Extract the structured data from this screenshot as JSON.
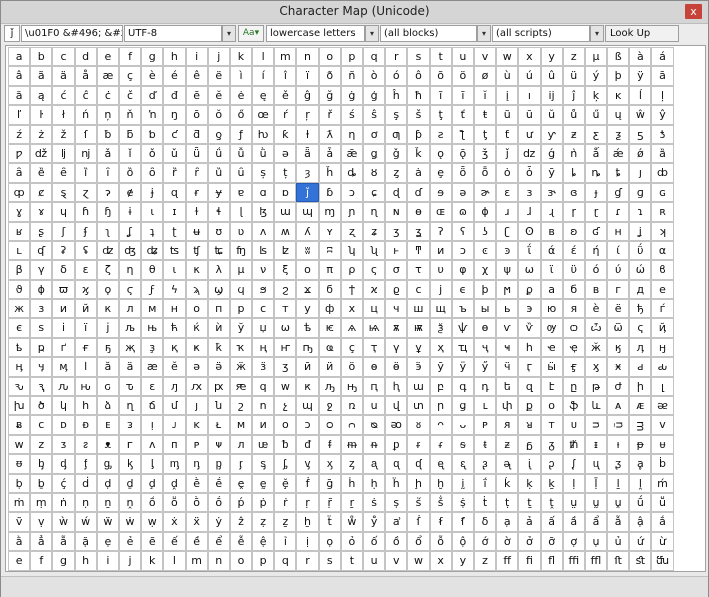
{
  "window": {
    "title": "Character Map (Unicode)",
    "close_glyph": "x"
  },
  "toolbar": {
    "selected_char": "ǰ",
    "code_fields": "\\u01F0  &#496;  &#x1F0;",
    "encoding": "UTF-8",
    "char_picker_icon": "character-picker-icon",
    "filter": "lowercase letters",
    "block": "(all blocks)",
    "script": "(all scripts)",
    "lookup_label": "Look Up",
    "dropdown_arrow": "▾"
  },
  "grid": {
    "selected_row": 7,
    "selected_col": 13,
    "rows": [
      "a b c d e f g h i j k l m n o p q r s t u v w x y z µ ß à á",
      "â ã ä å æ ç è é ê ë ì í î ï ð ñ ò ó ô õ ö ø ù ú û ü ý þ ÿ ā",
      "ă ą ć ĉ ċ č ď đ ē ĕ ė ę ě ĝ ğ ġ ģ ĥ ħ ĩ ī ĭ į ı ĳ ĵ ķ ĸ ĺ ļ",
      "ľ ŀ ł ń ņ ň ŉ ŋ ō ŏ ő œ ŕ ŗ ř ś ŝ ş š ţ ť ŧ ũ ū ŭ ů ű ų ŵ ŷ",
      "ź ż ž ſ ƀ ƃ ƅ ƈ ƌ ƍ ƒ ƕ ƙ ƚ ƛ ƞ ơ ƣ ƥ ƨ ƪ ƫ ƭ ư ƴ ƶ ƹ ƺ ƽ ƾ",
      "ƿ ǆ ǉ ǌ ǎ ǐ ǒ ǔ ǖ ǘ ǚ ǜ ǝ ǟ ǡ ǣ ǥ ǧ ǩ ǫ ǭ ǯ ǰ ǳ ǵ ǹ ǻ ǽ ǿ ȁ",
      "ȃ ȅ ȇ ȉ ȋ ȍ ȏ ȑ ȓ ȕ ȗ ș ț ȝ ȟ ȡ ȣ ȥ ȧ ȩ ȫ ȭ ȯ ȱ ȳ ȴ ȵ ȶ ȷ ȸ",
      "ȹ ȼ ȿ ɀ ɂ ɇ ɉ ɋ ɍ ɏ ɐ ɑ ɒ ǰ ɓ ɔ ɕ ɖ ɗ ɘ ə ɚ ɛ ɜ ɝ ɞ ɟ ɠ ɡ ɢ",
      "ɣ ɤ ɥ ɦ ɧ ɨ ɩ ɪ ɫ ɬ ɭ ɮ ɯ ɰ ɱ ɲ ɳ ɴ ɵ ɶ ɷ ɸ ɹ ɺ ɻ ɼ ɽ ɾ ɿ ʀ",
      "ʁ ʂ ʃ ʄ ʅ ʆ ʇ ʈ ʉ ʊ ʋ ʌ ʍ ʎ ʏ ʐ ʑ ʒ ʓ ʔ ʕ ʖ ʗ ʘ ʙ ʚ ʛ ʜ ʝ ʞ",
      "ʟ ʠ ʡ ʢ ʣ ʤ ʥ ʦ ʧ ʨ ʩ ʪ ʫ ʬ ʭ ʮ ʯ ͱ ͳ ͷ ͻ ͼ ͽ ΐ ά έ ή ί ΰ α",
      "β γ δ ε ζ η θ ι κ λ μ ν ξ ο π ρ ς σ τ υ φ χ ψ ω ϊ ϋ ό ύ ώ ϐ",
      "ϑ ϕ ϖ ϗ ϙ ϛ ϝ ϟ ϡ ϣ ϥ ϧ ϩ ϫ ϭ ϯ ϰ ϱ ϲ ϳ ϵ ϸ ϻ ϼ а б в г д е",
      "ж з и й к л м н о п р с т у ф х ц ч ш щ ъ ы ь э ю я ѐ ё ђ ѓ",
      "є ѕ і ї ј љ њ ћ ќ ѝ ў џ ѡ ѣ ѥ ѧ ѩ ѫ ѭ ѯ ѱ ѳ ѵ ѷ ѹ ѻ ѽ ѿ ҁ ҋ",
      "ҍ ҏ ґ ғ ҕ җ ҙ қ ҝ ҟ ҡ ң ҥ ҧ ҩ ҫ ҭ ү ұ ҳ ҵ ҷ ҹ һ ҽ ҿ ӂ ӄ ӆ ӈ",
      "ӊ ӌ ӎ ӏ ӑ ӓ ӕ ӗ ә ӛ ӝ ӟ ӡ ӣ ӥ ӧ ө ӫ ӭ ӯ ӱ ӳ ӵ ӷ ӹ ӻ ӽ ӿ ԁ ԃ",
      "ԅ ԇ ԉ ԋ ԍ ԏ ԑ ԓ ԕ ԗ ԙ ԛ ԝ ԟ ԡ ԣ ԥ ԧ ա բ գ դ ե զ է ը թ ժ ի լ",
      "խ ծ կ հ ձ ղ ճ մ յ ն շ ո չ պ ջ ռ ս վ տ ր ց ւ փ ք օ ֆ և ᴀ ᴁ ᴂ",
      "ᴃ ᴄ ᴅ ᴆ ᴇ ᴈ ᴉ ᴊ ᴋ ᴌ ᴍ ᴎ ᴏ ᴐ ᴑ ᴒ ᴓ ᴔ ᴕ ᴖ ᴗ ᴘ ᴙ ᴚ ᴛ ᴜ ᴝ ᴞ ᴟ ᴠ",
      "ᴡ ᴢ ᴣ ᴤ ᴥ ᴦ ᴧ ᴨ ᴩ ᴪ ᴫ ᵫ ᵬ ᵭ ᵮ ᵯ ᵰ ᵱ ᵲ ᵳ ᵴ ᵵ ᵶ ᵷ ᵹ ᵺ ᵻ ᵼ ᵽ ᵾ",
      "ᵿ ᶀ ᶁ ᶂ ᶃ ᶄ ᶅ ᶆ ᶇ ᶈ ᶉ ᶊ ᶋ ᶌ ᶍ ᶎ ᶏ ᶐ ᶑ ᶒ ᶓ ᶔ ᶕ ᶖ ᶗ ᶘ ᶙ ᶚ ḁ ḃ",
      "ḅ ḇ ḉ ḋ ḍ ḏ ḑ ḓ ḕ ḗ ḙ ḛ ḝ ḟ ḡ ḣ ḥ ḧ ḩ ḫ ḭ ḯ ḱ ḳ ḵ ḷ ḹ ḻ ḽ ḿ",
      "ṁ ṃ ṅ ṇ ṉ ṋ ṍ ṏ ṑ ṓ ṕ ṗ ṙ ṛ ṝ ṟ ṡ ṣ ṥ ṧ ṩ ṫ ṭ ṯ ṱ ṳ ṵ ṷ ṹ ṻ",
      "ṽ ṿ ẁ ẃ ẅ ẇ ẉ ẋ ẍ ẏ ẑ ẓ ẕ ẖ ẗ ẘ ẙ ẚ ẛ ẜ ẝ ẟ ạ ả ấ ầ ẩ ẫ ậ ắ",
      "ằ ẳ ẵ ặ ẹ ẻ ẽ ế ề ể ễ ệ ỉ ị ọ ỏ ố ồ ổ ỗ ộ ớ ờ ở ỡ ợ ụ ủ ứ ừ",
      "e f g h i j k l m n o p q r s t u v w x y z ﬀ ﬁ ﬂ ﬃ ﬄ ﬅ ﬆ ﬓ"
    ]
  }
}
